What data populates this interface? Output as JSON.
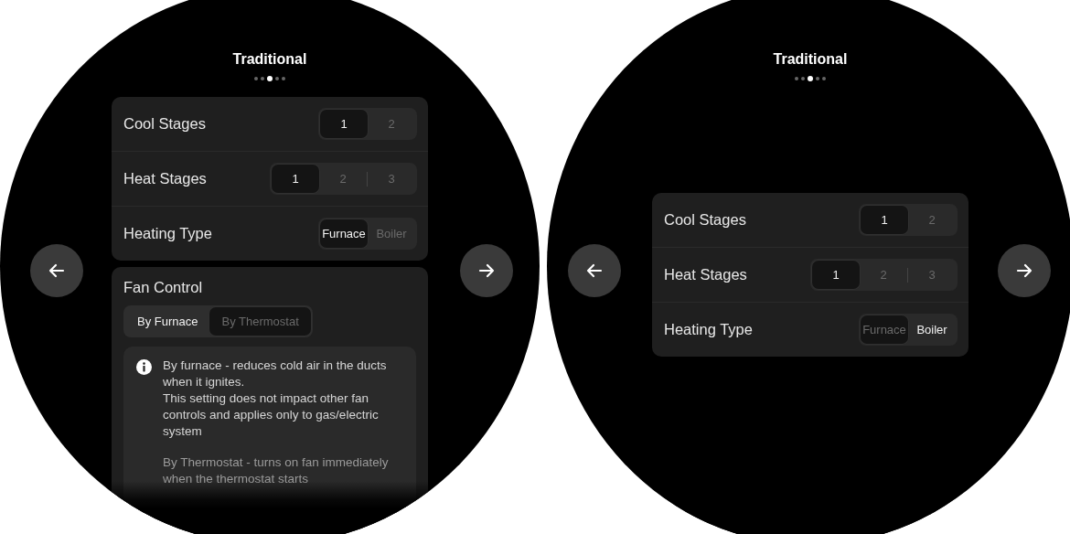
{
  "screens": [
    {
      "title": "Traditional",
      "pages": [
        {
          "selected": false
        },
        {
          "selected": false
        },
        {
          "selected": true
        },
        {
          "selected": false
        },
        {
          "selected": false
        }
      ],
      "settings": [
        {
          "label": "Cool Stages",
          "options": [
            {
              "label": "1",
              "selected": true,
              "highlighted": true
            },
            {
              "label": "2",
              "selected": false,
              "highlighted": false
            }
          ]
        },
        {
          "label": "Heat Stages",
          "options": [
            {
              "label": "1",
              "selected": true,
              "highlighted": true
            },
            {
              "label": "2",
              "selected": false,
              "highlighted": false
            },
            {
              "label": "3",
              "selected": false,
              "highlighted": false
            }
          ]
        },
        {
          "label": "Heating Type",
          "options": [
            {
              "label": "Furnace",
              "selected": true,
              "highlighted": true
            },
            {
              "label": "Boiler",
              "selected": false,
              "highlighted": false
            }
          ]
        }
      ],
      "fan_control": {
        "title": "Fan Control",
        "options": [
          {
            "label": "By Furnace",
            "selected": true,
            "highlighted": false
          },
          {
            "label": "By Thermostat",
            "selected": false,
            "highlighted": true
          }
        ],
        "info": [
          "By furnace - reduces cold air in the ducts when it ignites.\nThis setting does not impact other fan controls and applies only to gas/electric system",
          "By Thermostat  - turns on fan immediately when the thermostat starts"
        ]
      }
    },
    {
      "title": "Traditional",
      "pages": [
        {
          "selected": false
        },
        {
          "selected": false
        },
        {
          "selected": true
        },
        {
          "selected": false
        },
        {
          "selected": false
        }
      ],
      "settings": [
        {
          "label": "Cool Stages",
          "options": [
            {
              "label": "1",
              "selected": true,
              "highlighted": true
            },
            {
              "label": "2",
              "selected": false,
              "highlighted": false
            }
          ]
        },
        {
          "label": "Heat Stages",
          "options": [
            {
              "label": "1",
              "selected": true,
              "highlighted": true
            },
            {
              "label": "2",
              "selected": false,
              "highlighted": false
            },
            {
              "label": "3",
              "selected": false,
              "highlighted": false
            }
          ]
        },
        {
          "label": "Heating Type",
          "options": [
            {
              "label": "Furnace",
              "selected": false,
              "highlighted": true
            },
            {
              "label": "Boiler",
              "selected": true,
              "highlighted": false
            }
          ]
        }
      ]
    }
  ]
}
